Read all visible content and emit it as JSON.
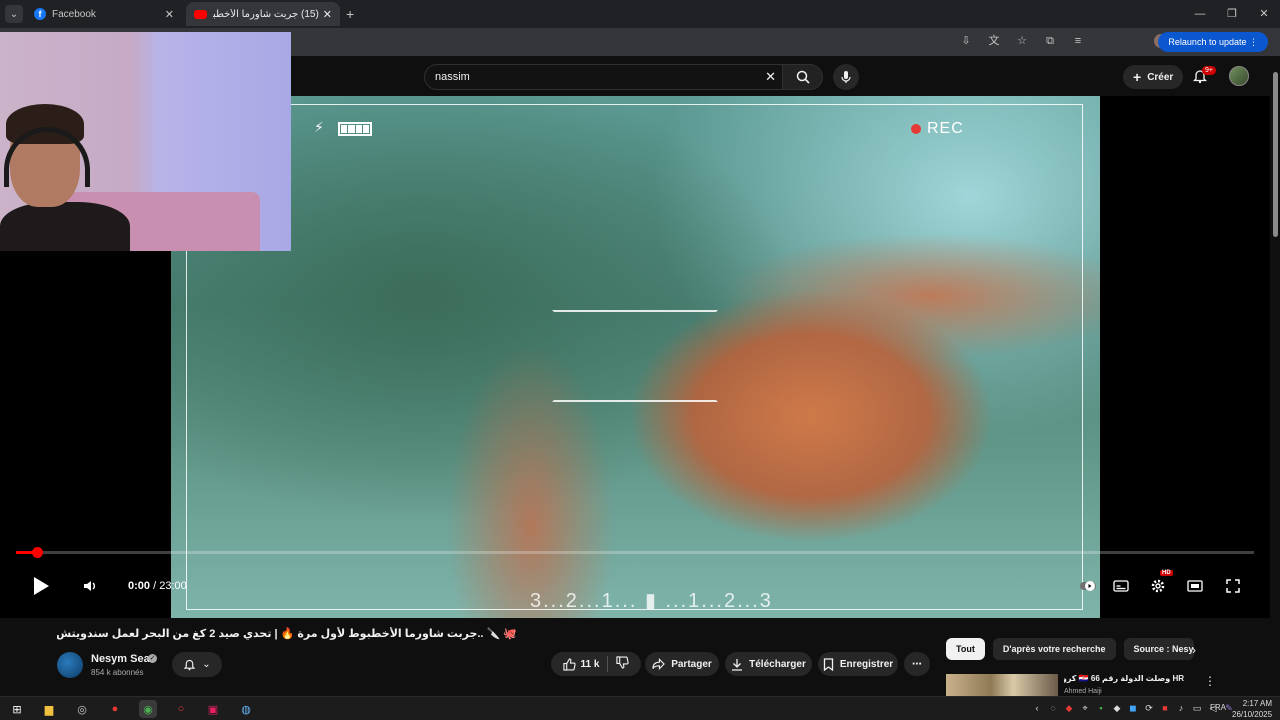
{
  "browser": {
    "tabs": [
      {
        "title": "Facebook",
        "icon": "facebook-icon",
        "active": false
      },
      {
        "title": "(15) جربت شاورما الأخطبوط لأول...",
        "icon": "youtube-icon",
        "active": true
      }
    ],
    "relaunch_label": "Relaunch to update"
  },
  "header": {
    "search_value": "nassim",
    "create_label": "Créer",
    "notification_count": "9+"
  },
  "player": {
    "overlay_rec": "REC",
    "overlay_countdown": "3...2...1... ▮ ...1...2...3",
    "time_current": "0:00",
    "time_total": "23:00",
    "time_separator": " / ",
    "progress": 0.017,
    "quality_badge": "HD"
  },
  "video": {
    "title": "🐙 🔪 ..جربت شاورما الأخطبوط لأول مرة 🔥 | تحدي صيد 2 كغ من البحر لعمل سندويتش ضخم جدًا",
    "channel_name": "Nesym Sea",
    "subscribers": "854 k abonnés",
    "like_count": "11 k",
    "share_label": "Partager",
    "download_label": "Télécharger",
    "save_label": "Enregistrer"
  },
  "related": {
    "chips": [
      "Tout",
      "D'après votre recherche",
      "Source : Nesym"
    ],
    "first_item": {
      "title": "HR وصلت الدولة رقم 66 🇭🇷 كرواتيا",
      "channel": "Ahmed Haiji"
    }
  },
  "taskbar": {
    "language": "FRA",
    "time": "2:17 AM",
    "date": "26/10/2025"
  },
  "colors": {
    "accent_red": "#ff0000",
    "relaunch_blue": "#0b57d0",
    "background": "#0f0f0f"
  }
}
